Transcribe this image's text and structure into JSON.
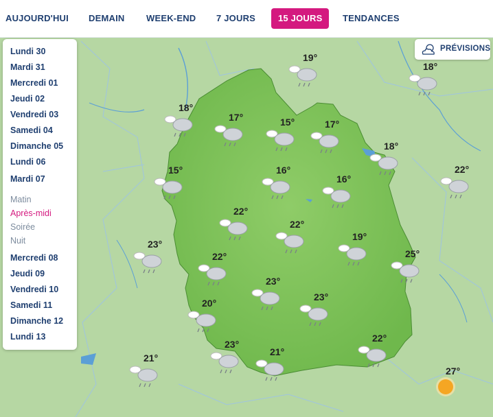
{
  "tabs": [
    {
      "label": "AUJOURD'HUI",
      "active": false
    },
    {
      "label": "DEMAIN",
      "active": false
    },
    {
      "label": "WEEK-END",
      "active": false
    },
    {
      "label": "7 JOURS",
      "active": false
    },
    {
      "label": "15 JOURS",
      "active": true
    },
    {
      "label": "TENDANCES",
      "active": false
    }
  ],
  "days_before": [
    "Lundi 30",
    "Mardi 31",
    "Mercredi 01",
    "Jeudi 02",
    "Vendredi 03",
    "Samedi 04",
    "Dimanche 05",
    "Lundi 06",
    "Mardi 07"
  ],
  "periods": [
    {
      "label": "Matin",
      "active": false
    },
    {
      "label": "Après-midi",
      "active": true
    },
    {
      "label": "Soirée",
      "active": false
    },
    {
      "label": "Nuit",
      "active": false
    }
  ],
  "days_after": [
    "Mercredi 08",
    "Jeudi 09",
    "Vendredi 10",
    "Samedi 11",
    "Dimanche 12",
    "Lundi 13"
  ],
  "previsions": {
    "label": "PRÉVISIONS",
    "icon": "partly-cloudy-icon"
  },
  "colors": {
    "accent": "#d4197f",
    "nav_text": "#1f3f70",
    "region_fill": "#7fc45a",
    "surrounding": "#b6d7a3",
    "water": "#5b9fd6",
    "sun": "#f5a623"
  },
  "stations": [
    {
      "temp": "19°",
      "icon": "rain-cloud-icon"
    },
    {
      "temp": "18°",
      "icon": "rain-cloud-icon"
    },
    {
      "temp": "18°",
      "icon": "rain-cloud-icon"
    },
    {
      "temp": "17°",
      "icon": "rain-cloud-icon"
    },
    {
      "temp": "15°",
      "icon": "rain-cloud-icon"
    },
    {
      "temp": "17°",
      "icon": "rain-cloud-icon"
    },
    {
      "temp": "18°",
      "icon": "rain-cloud-icon"
    },
    {
      "temp": "15°",
      "icon": "rain-cloud-icon"
    },
    {
      "temp": "16°",
      "icon": "rain-cloud-icon"
    },
    {
      "temp": "16°",
      "icon": "rain-cloud-icon"
    },
    {
      "temp": "22°",
      "icon": "rain-cloud-icon"
    },
    {
      "temp": "22°",
      "icon": "rain-cloud-icon"
    },
    {
      "temp": "22°",
      "icon": "rain-cloud-icon"
    },
    {
      "temp": "23°",
      "icon": "rain-cloud-icon"
    },
    {
      "temp": "19°",
      "icon": "rain-cloud-icon"
    },
    {
      "temp": "22°",
      "icon": "rain-cloud-icon"
    },
    {
      "temp": "25°",
      "icon": "rain-cloud-icon"
    },
    {
      "temp": "23°",
      "icon": "rain-cloud-icon"
    },
    {
      "temp": "20°",
      "icon": "rain-cloud-icon"
    },
    {
      "temp": "23°",
      "icon": "rain-cloud-icon"
    },
    {
      "temp": "22°",
      "icon": "rain-cloud-icon"
    },
    {
      "temp": "23°",
      "icon": "rain-cloud-icon"
    },
    {
      "temp": "21°",
      "icon": "rain-cloud-icon"
    },
    {
      "temp": "21°",
      "icon": "rain-cloud-icon"
    },
    {
      "temp": "27°",
      "icon": "sun-icon"
    }
  ]
}
